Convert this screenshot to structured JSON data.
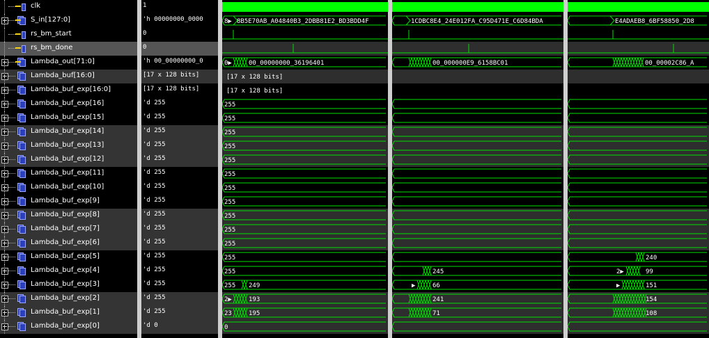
{
  "colors": {
    "wave": "#00e000",
    "clk_bar": "#00ff00",
    "bg": "#000000",
    "alt_row": "#343434",
    "separator": "#cfcfcf"
  },
  "signals": [
    {
      "name": "clk",
      "value": "1",
      "icon": "input-port-icon",
      "expand": false
    },
    {
      "name": "S_in[127:0]",
      "value": "'h 00000000_0000",
      "icon": "bus-input-icon",
      "expand": true
    },
    {
      "name": "rs_bm_start",
      "value": "0",
      "icon": "input-port-icon",
      "expand": false
    },
    {
      "name": "rs_bm_done",
      "value": "0",
      "icon": "output-port-icon",
      "expand": false
    },
    {
      "name": "Lambda_out[71:0]",
      "value": "'h 00_00000000_0",
      "icon": "bus-output-icon",
      "expand": true
    },
    {
      "name": "Lambda_buf[16:0]",
      "value": "[17 x 128 bits]",
      "icon": "array-icon",
      "expand": true
    },
    {
      "name": "Lambda_buf_exp[16:0]",
      "value": "[17 x 128 bits]",
      "icon": "array-icon",
      "expand": true
    },
    {
      "name": "Lambda_buf_exp[16]",
      "value": "'d 255",
      "icon": "bus-icon",
      "expand": true
    },
    {
      "name": "Lambda_buf_exp[15]",
      "value": "'d 255",
      "icon": "bus-icon",
      "expand": true
    },
    {
      "name": "Lambda_buf_exp[14]",
      "value": "'d 255",
      "icon": "bus-icon",
      "expand": true
    },
    {
      "name": "Lambda_buf_exp[13]",
      "value": "'d 255",
      "icon": "bus-icon",
      "expand": true
    },
    {
      "name": "Lambda_buf_exp[12]",
      "value": "'d 255",
      "icon": "bus-icon",
      "expand": true
    },
    {
      "name": "Lambda_buf_exp[11]",
      "value": "'d 255",
      "icon": "bus-icon",
      "expand": true
    },
    {
      "name": "Lambda_buf_exp[10]",
      "value": "'d 255",
      "icon": "bus-icon",
      "expand": true
    },
    {
      "name": "Lambda_buf_exp[9]",
      "value": "'d 255",
      "icon": "bus-icon",
      "expand": true
    },
    {
      "name": "Lambda_buf_exp[8]",
      "value": "'d 255",
      "icon": "bus-icon",
      "expand": true
    },
    {
      "name": "Lambda_buf_exp[7]",
      "value": "'d 255",
      "icon": "bus-icon",
      "expand": true
    },
    {
      "name": "Lambda_buf_exp[6]",
      "value": "'d 255",
      "icon": "bus-icon",
      "expand": true
    },
    {
      "name": "Lambda_buf_exp[5]",
      "value": "'d 255",
      "icon": "bus-icon",
      "expand": true
    },
    {
      "name": "Lambda_buf_exp[4]",
      "value": "'d 255",
      "icon": "bus-icon",
      "expand": true
    },
    {
      "name": "Lambda_buf_exp[3]",
      "value": "'d 255",
      "icon": "bus-icon",
      "expand": true
    },
    {
      "name": "Lambda_buf_exp[2]",
      "value": "'d 255",
      "icon": "bus-icon",
      "expand": true
    },
    {
      "name": "Lambda_buf_exp[1]",
      "value": "'d 255",
      "icon": "bus-icon",
      "expand": true
    },
    {
      "name": "Lambda_buf_exp[0]",
      "value": "'d 0",
      "icon": "bus-icon",
      "expand": true
    }
  ],
  "wave_labels": {
    "s_in": [
      "8▶",
      "8B5E70AB_A04840B3_2DBB81E2_BD3BDD4F",
      "1CDBC8E4_24E012FA_C95D471E_C6D84BDA",
      "E4ADAEB8_6BF58850_2D8"
    ],
    "lambda_out": [
      "0▶",
      "00_00000000_36196401",
      "00_000000E9_6158BC01",
      "00_00002C86_A"
    ],
    "lambda_buf": "[17 x 128 bits]",
    "lambda_buf_exp": "[17 x 128 bits]",
    "exp16": [
      "255"
    ],
    "exp15": [
      "255"
    ],
    "exp14": [
      "255"
    ],
    "exp13": [
      "255"
    ],
    "exp12": [
      "255"
    ],
    "exp11": [
      "255"
    ],
    "exp10": [
      "255"
    ],
    "exp9": [
      "255"
    ],
    "exp8": [
      "255"
    ],
    "exp7": [
      "255"
    ],
    "exp6": [
      "255"
    ],
    "exp5": [
      "255",
      "240"
    ],
    "exp4": [
      "255",
      "245",
      "2▶",
      "99"
    ],
    "exp3": [
      "255",
      "249",
      "▶",
      "66",
      "▶",
      "151"
    ],
    "exp2": [
      "2▶",
      "193",
      "241",
      "154"
    ],
    "exp1": [
      "23",
      "195",
      "71",
      "108"
    ],
    "exp0": [
      "0"
    ]
  }
}
